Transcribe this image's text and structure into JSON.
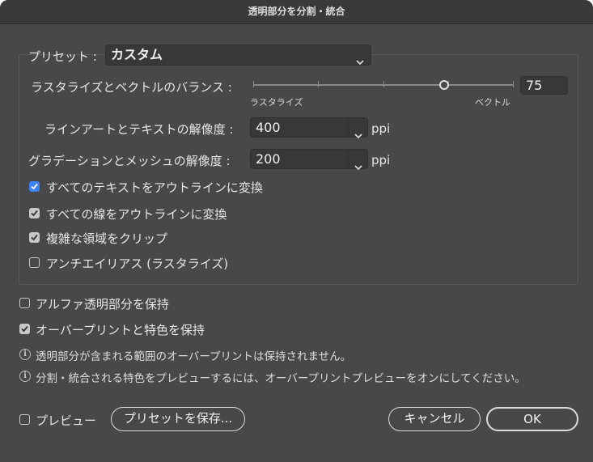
{
  "window": {
    "title": "透明部分を分割・統合"
  },
  "preset": {
    "label": "プリセット :",
    "value": "カスタム"
  },
  "balance": {
    "label": "ラスタライズとベクトルのバランス :",
    "left_label": "ラスタライズ",
    "right_label": "ベクトル",
    "value": "75",
    "level_percent": 75
  },
  "line_art": {
    "label": "ラインアートとテキストの解像度 :",
    "value": "400",
    "unit": "ppi"
  },
  "gradient": {
    "label": "グラデーションとメッシュの解像度 :",
    "value": "200",
    "unit": "ppi"
  },
  "checkboxes": [
    {
      "label": "すべてのテキストをアウトラインに変換",
      "checked": true
    },
    {
      "label": "すべての線をアウトラインに変換",
      "checked": true
    },
    {
      "label": "複雑な領域をクリップ",
      "checked": true
    },
    {
      "label": "アンチエイリアス (ラスタライズ)",
      "checked": false
    }
  ],
  "options": [
    {
      "label": "アルファ透明部分を保持",
      "checked": false
    },
    {
      "label": "オーバープリントと特色を保持",
      "checked": true
    }
  ],
  "info": [
    "透明部分が含まれる範囲のオーバープリントは保持されません。",
    "分割・統合される特色をプレビューするには、オーバープリントプレビューをオンにしてください。"
  ],
  "footer": {
    "preview_label": "プレビュー",
    "preview_checked": false,
    "save_preset_label": "プリセットを保存...",
    "cancel_label": "キャンセル",
    "ok_label": "OK"
  },
  "colors": {
    "accent": "#3b82f6",
    "background": "#484848"
  }
}
